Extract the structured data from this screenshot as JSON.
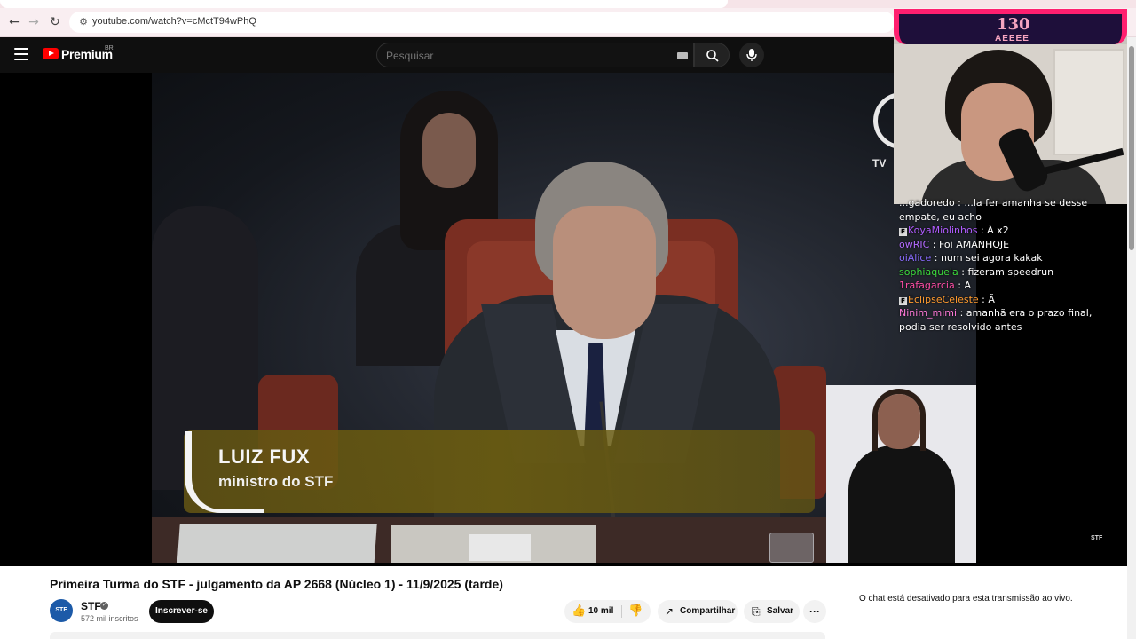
{
  "browser": {
    "url": "youtube.com/watch?v=cMctT94wPhQ",
    "back_icon": "arrow-left-icon",
    "forward_icon": "arrow-right-icon",
    "reload_icon": "reload-icon"
  },
  "header": {
    "brand": "Premium",
    "region": "BR",
    "search_placeholder": "Pesquisar"
  },
  "video": {
    "lower_third_name": "LUIZ FUX",
    "lower_third_role": "ministro do STF",
    "tv_badge": "TV",
    "watermark": "STF"
  },
  "stream_overlay": {
    "count": "130",
    "name": "AEEEE",
    "accent_color": "#ff1f6f",
    "chat": [
      {
        "user": "...gadoredo",
        "color": "#ffffff",
        "text": "...la fer amanha se desse empate, eu acho",
        "badge": false
      },
      {
        "user": "KoyaMiolinhos",
        "color": "#b05cff",
        "text": "Ã x2",
        "badge": true
      },
      {
        "user": "owRIC",
        "color": "#b36bff",
        "text": "Foi AMANHOJE",
        "badge": false
      },
      {
        "user": "oiAlice",
        "color": "#8a6cff",
        "text": "num sei agora kakak",
        "badge": false
      },
      {
        "user": "sophiaquela",
        "color": "#3ddc3d",
        "text": "fizeram speedrun",
        "badge": false
      },
      {
        "user": "1rafagarcia",
        "color": "#ff4da6",
        "text": "Ã",
        "badge": false
      },
      {
        "user": "EclipseCeleste",
        "color": "#ff9b2f",
        "text": "Ã",
        "badge": true
      },
      {
        "user": "Ninim_mimi",
        "color": "#ff7ad9",
        "text": "amanhã era o prazo final, podia ser resolvido antes",
        "badge": false
      }
    ]
  },
  "below": {
    "title": "Primeira Turma do STF - julgamento da AP 2668 (Núcleo 1) - 11/9/2025 (tarde)",
    "channel": "STF",
    "channel_avatar": "STF",
    "subscribers": "572 mil inscritos",
    "subscribe": "Inscrever-se",
    "likes": "10 mil",
    "share": "Compartilhar",
    "save": "Salvar",
    "more": "···",
    "chat_disabled": "O chat está desativado para esta transmissão ao vivo."
  }
}
